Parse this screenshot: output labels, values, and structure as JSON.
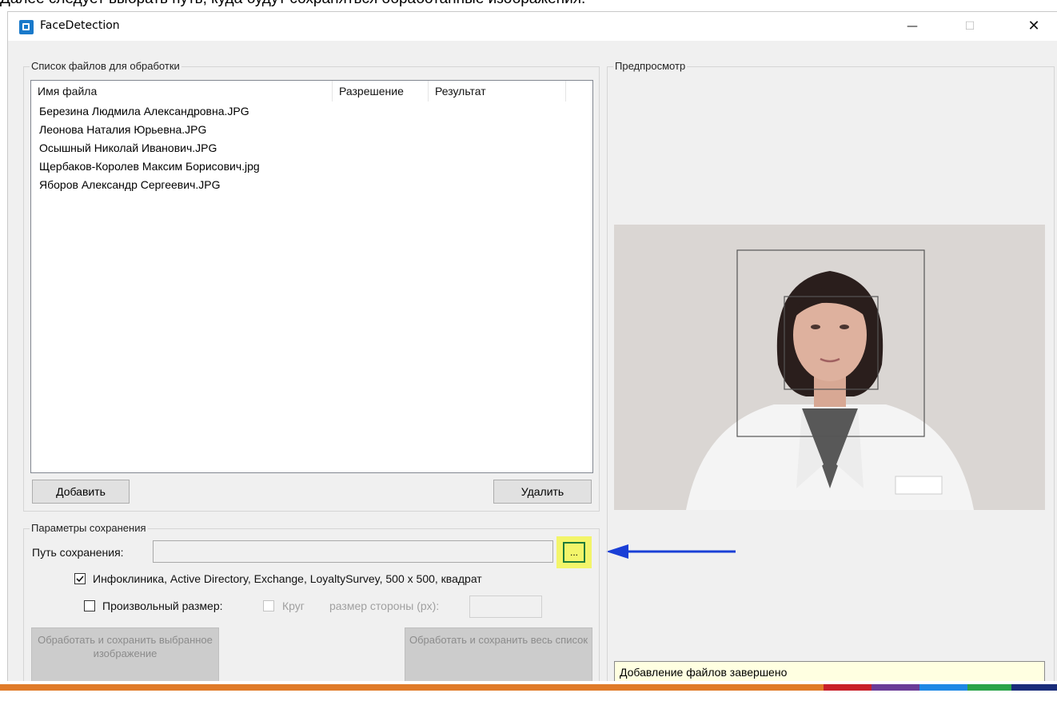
{
  "page_caption": "Далее следует выбрать путь, куда будут сохраняться обработанные изображения.",
  "window": {
    "title": "FaceDetection",
    "minimize_glyph": "—",
    "maximize_glyph": "☐",
    "close_glyph": "✕"
  },
  "file_list": {
    "group_label": "Список файлов для обработки",
    "columns": [
      "Имя файла",
      "Разрешение",
      "Результат"
    ],
    "rows": [
      "Березина Людмила Александровна.JPG",
      "Леонова Наталия Юрьевна.JPG",
      "Осышный Николай Иванович.JPG",
      "Щербаков-Королев Максим Борисович.jpg",
      "Яборов Александр Сергеевич.JPG"
    ],
    "add_label": "Добавить",
    "remove_label": "Удалить"
  },
  "save_params": {
    "group_label": "Параметры сохранения",
    "path_label": "Путь сохранения:",
    "path_value": "",
    "browse_label": "...",
    "preset_checked": true,
    "preset_label": "Инфоклиника, Active Directory, Exchange, LoyaltySurvey, 500 x 500, квадрат",
    "custom_checked": false,
    "custom_label": "Произвольный размер:",
    "circle_label": "Круг",
    "side_label": "размер стороны (px):",
    "side_value": "",
    "process_selected_label": "Обработать и сохранить выбранное изображение",
    "process_all_label": "Обработать и сохранить весь список"
  },
  "preview": {
    "group_label": "Предпросмотр",
    "status_text": "Добавление файлов завершено"
  },
  "colors": {
    "highlight": "#f3f56a",
    "arrow": "#1a3fd6",
    "taskbar_segments": [
      "#e07b29",
      "#c8202a",
      "#6a3c97",
      "#1e88e5",
      "#2aa34a",
      "#1a2d7a"
    ]
  }
}
